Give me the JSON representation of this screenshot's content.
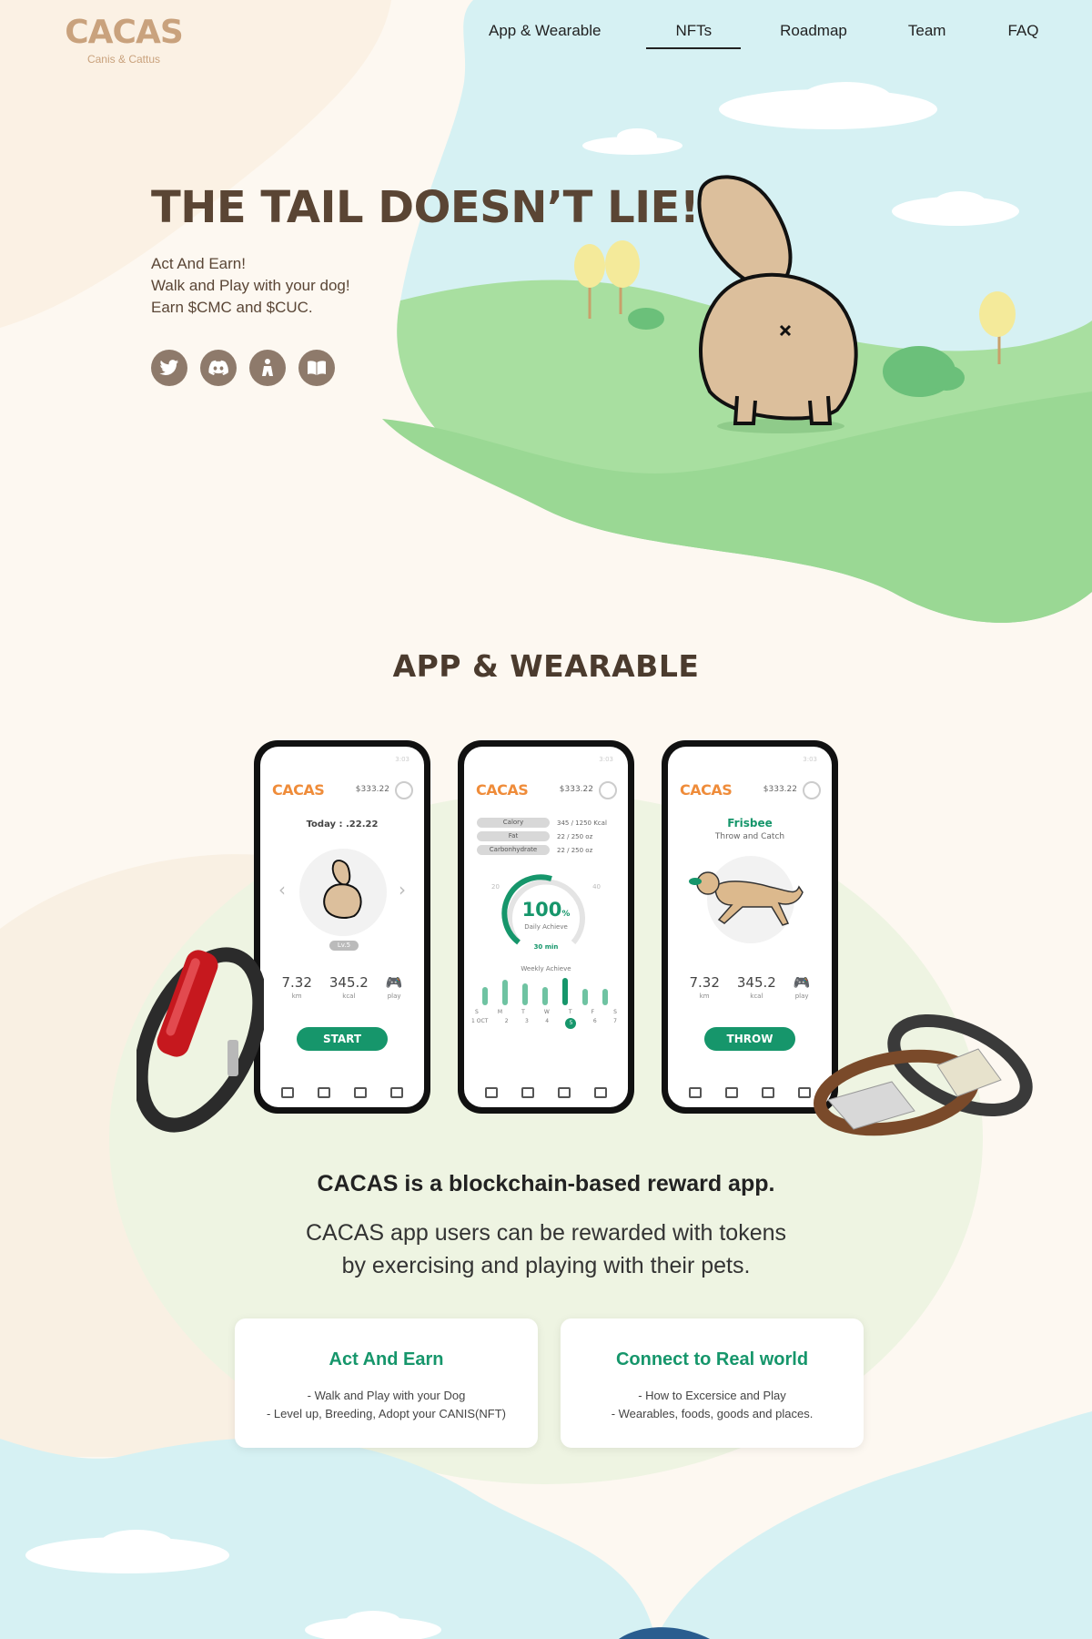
{
  "brand": {
    "name": "CACAS",
    "subtitle": "Canis & Cattus"
  },
  "nav": {
    "items": [
      "App & Wearable",
      "NFTs",
      "Roadmap",
      "Team",
      "FAQ"
    ],
    "active": "NFTs"
  },
  "hero": {
    "title": "THE TAIL DOESN’T LIE!",
    "lines": [
      "Act And Earn!",
      "Walk and Play with your dog!",
      "Earn $CMC and $CUC."
    ],
    "socials": [
      "twitter-icon",
      "discord-icon",
      "homepage-icon",
      "whitepaper-book-icon"
    ]
  },
  "app_section": {
    "title": "APP & WEARABLE",
    "phones": {
      "balance": "$333.22",
      "status": "3:03",
      "home": {
        "today": "Today : .22.22",
        "level": "Lv.5",
        "km": "7.32",
        "km_unit": "km",
        "kcal": "345.2",
        "kcal_unit": "kcal",
        "play_unit": "play",
        "button": "START"
      },
      "stats": {
        "nutrients": [
          {
            "label": "Calory",
            "value": "345 / 1250 Kcal"
          },
          {
            "label": "Fat",
            "value": "22 / 250 oz"
          },
          {
            "label": "Carbonhydrate",
            "value": "22 / 250 oz"
          }
        ],
        "gauge_min": "20",
        "gauge_max": "40",
        "percent": "100",
        "percent_sign": "%",
        "gauge_label": "Daily Achieve",
        "minutes": "30 min",
        "weekly_label": "Weekly Achieve",
        "days": [
          "S",
          "M",
          "T",
          "W",
          "T",
          "F",
          "S"
        ],
        "dates": [
          "1 OCT",
          "2",
          "3",
          "4",
          "5",
          "6",
          "7"
        ]
      },
      "play": {
        "game": "Frisbee",
        "subtitle": "Throw and Catch",
        "km": "7.32",
        "km_unit": "km",
        "kcal": "345.2",
        "kcal_unit": "kcal",
        "play_unit": "play",
        "button": "THROW"
      }
    },
    "tagline": "CACAS is a blockchain-based reward app.",
    "description": [
      "CACAS app users can be rewarded with tokens",
      "by exercising and playing with their pets."
    ],
    "cards": [
      {
        "title": "Act And Earn",
        "lines": [
          "- Walk and Play with your Dog",
          "- Level up, Breeding, Adopt your CANIS(NFT)"
        ]
      },
      {
        "title": "Connect to Real world",
        "lines": [
          "- How to Excersice and Play",
          "- Wearables, foods, goods and places."
        ]
      }
    ]
  },
  "colors": {
    "accent_green": "#16966b",
    "brand_tan": "#c9a27d",
    "sky": "#d6f1f3",
    "grass": "#a8dfa0",
    "title_brown": "#5a4534"
  }
}
